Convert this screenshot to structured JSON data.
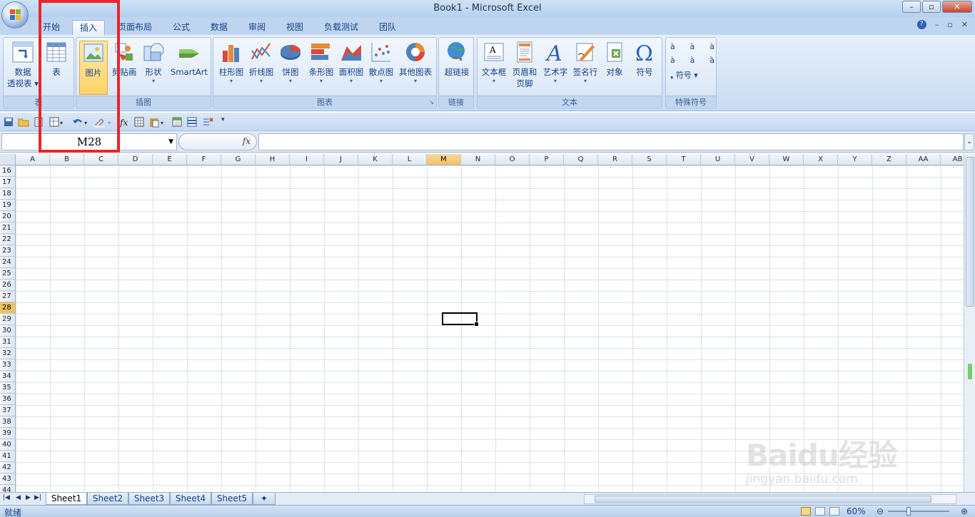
{
  "title": "Book1 - Microsoft Excel",
  "tabs": [
    "开始",
    "插入",
    "页面布局",
    "公式",
    "数据",
    "审阅",
    "视图",
    "负载测试",
    "团队"
  ],
  "active_tab": "插入",
  "ribbon": {
    "groups": [
      {
        "label": "表",
        "buttons": [
          "数据\n透视表",
          "表"
        ]
      },
      {
        "label": "插图",
        "buttons": [
          "图片",
          "剪贴画",
          "形状",
          "SmartArt"
        ]
      },
      {
        "label": "图表",
        "buttons": [
          "柱形图",
          "折线图",
          "饼图",
          "条形图",
          "面积图",
          "散点图",
          "其他图表"
        ]
      },
      {
        "label": "链接",
        "buttons": [
          "超链接"
        ]
      },
      {
        "label": "文本",
        "buttons": [
          "文本框",
          "页眉和\n页脚",
          "艺术字",
          "签名行",
          "对象",
          "符号"
        ]
      },
      {
        "label": "特殊符号",
        "buttons": [
          "符号"
        ]
      }
    ],
    "special_symbols": [
      "à",
      "à",
      "à",
      "à",
      "à",
      "à"
    ]
  },
  "formula_bar": {
    "name_box": "M28",
    "fx": "fx",
    "formula": ""
  },
  "columns": [
    "A",
    "B",
    "C",
    "D",
    "E",
    "F",
    "G",
    "H",
    "I",
    "J",
    "K",
    "L",
    "M",
    "N",
    "O",
    "P",
    "Q",
    "R",
    "S",
    "T",
    "U",
    "V",
    "W",
    "X",
    "Y",
    "Z",
    "AA",
    "AB"
  ],
  "rows": [
    "16",
    "17",
    "18",
    "19",
    "20",
    "21",
    "22",
    "23",
    "24",
    "25",
    "26",
    "27",
    "28",
    "29",
    "30",
    "31",
    "32",
    "33",
    "34",
    "35",
    "36",
    "37",
    "38",
    "39",
    "40",
    "41",
    "42",
    "43",
    "44"
  ],
  "selected_cell": {
    "column": "M",
    "row": "28"
  },
  "sheets": [
    "Sheet1",
    "Sheet2",
    "Sheet3",
    "Sheet4",
    "Sheet5"
  ],
  "active_sheet": "Sheet1",
  "status": {
    "ready": "就绪",
    "zoom": "60%"
  },
  "watermark": {
    "text": "Baidu经验",
    "sub": "jingyan.baidu.com"
  },
  "colors": {
    "highlight": "#e8262a",
    "selected_header": "#f1c15f"
  }
}
